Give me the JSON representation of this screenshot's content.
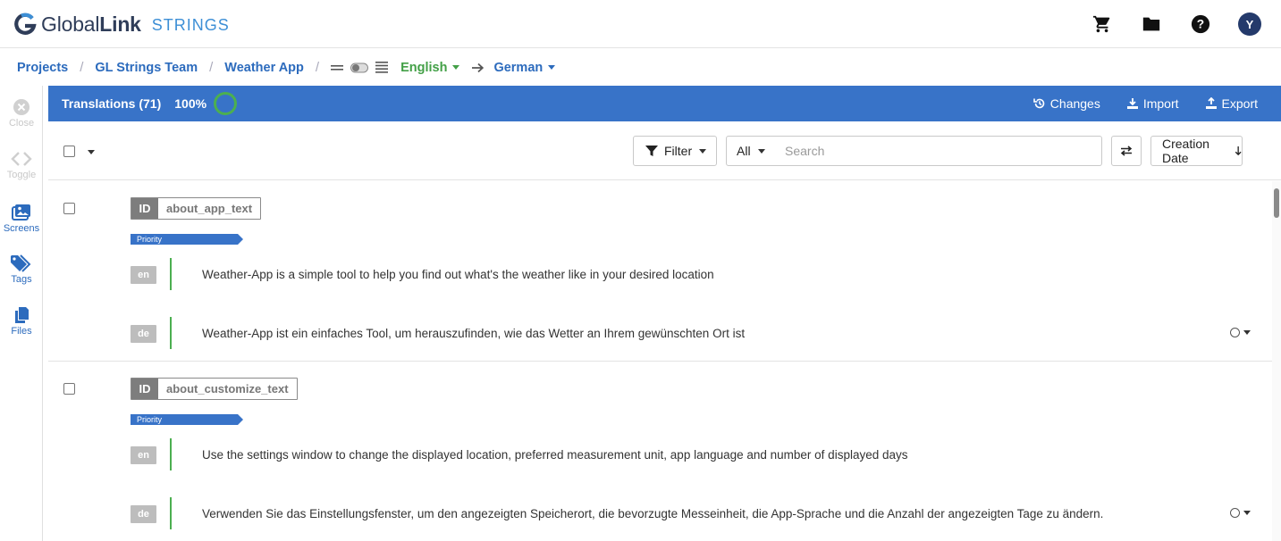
{
  "header": {
    "logo_main_a": "Global",
    "logo_main_b": "Link",
    "logo_sub": "STRINGS",
    "avatar_initial": "Y",
    "icons": [
      "cart-icon",
      "folder-icon",
      "help-icon"
    ]
  },
  "breadcrumb": {
    "items": [
      "Projects",
      "GL Strings Team",
      "Weather App"
    ],
    "separator": "/",
    "source_lang": "English",
    "target_lang": "German"
  },
  "sidebar": {
    "items": [
      {
        "label": "Close",
        "icon": "close-circle-icon",
        "enabled": false
      },
      {
        "label": "Toggle",
        "icon": "code-toggle-icon",
        "enabled": false
      },
      {
        "label": "Screens",
        "icon": "images-icon",
        "enabled": true
      },
      {
        "label": "Tags",
        "icon": "tags-icon",
        "enabled": true
      },
      {
        "label": "Files",
        "icon": "files-icon",
        "enabled": true
      }
    ]
  },
  "bluebar": {
    "title": "Translations (71)",
    "progress_label": "100%",
    "progress": 1.0,
    "changes": "Changes",
    "import": "Import",
    "export": "Export"
  },
  "toolbar": {
    "filter": "Filter",
    "scope": "All",
    "search_placeholder": "Search",
    "sort": "Creation Date"
  },
  "strings": [
    {
      "id_label": "ID",
      "id": "about_app_text",
      "tag": "Priority",
      "source_lang": "en",
      "source": "Weather-App is a simple tool to help you find out what's the weather like in your desired location",
      "target_lang": "de",
      "target": "Weather-App ist ein einfaches Tool, um herauszufinden, wie das Wetter an Ihrem gewünschten Ort ist"
    },
    {
      "id_label": "ID",
      "id": "about_customize_text",
      "tag": "Priority",
      "source_lang": "en",
      "source": "Use the settings window to change the displayed location, preferred measurement unit, app language and number of displayed days",
      "target_lang": "de",
      "target": "Verwenden Sie das Einstellungsfenster, um den angezeigten Speicherort, die bevorzugte Messeinheit, die App-Sprache und die Anzahl der angezeigten Tage zu ändern."
    }
  ],
  "colors": {
    "brand_blue": "#3873c8",
    "link_blue": "#2c6bbd",
    "source_green": "#43a047",
    "progress_green": "#4caf50"
  }
}
